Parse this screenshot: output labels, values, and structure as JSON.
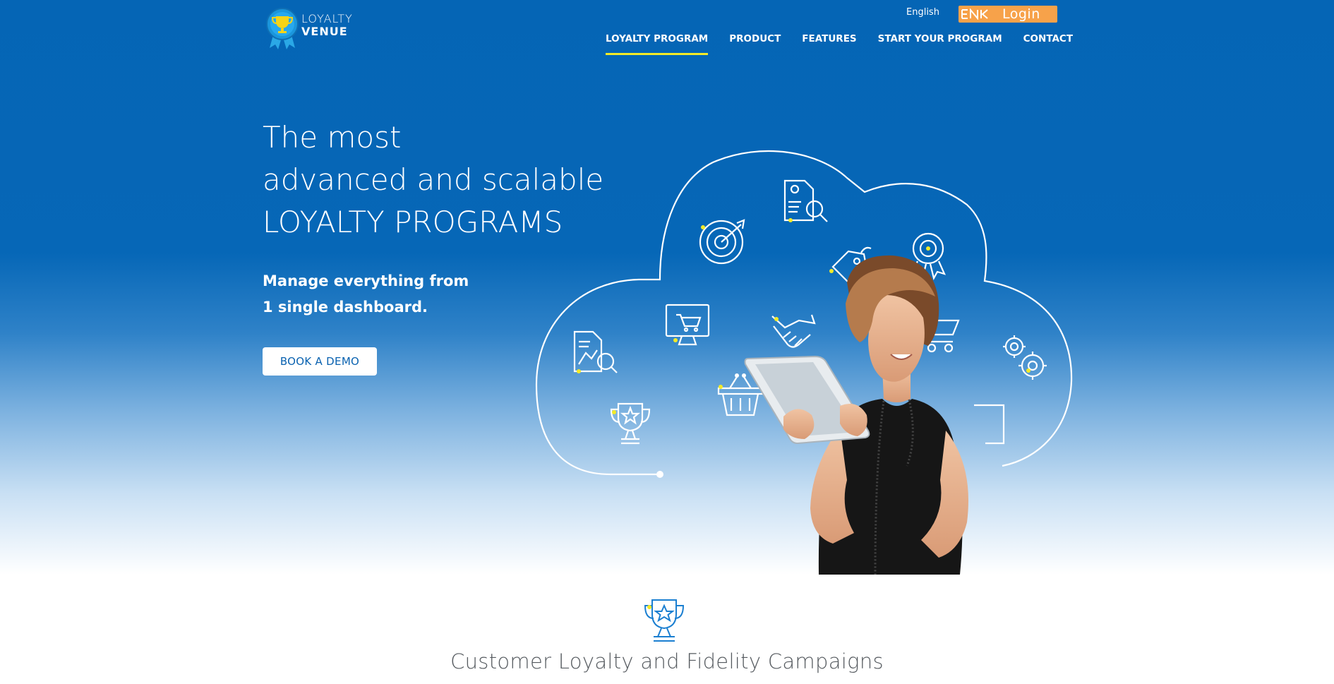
{
  "brand": {
    "line1": "LOYALTY",
    "line2": "VENUE",
    "logo_icon": "trophy-ribbon-icon"
  },
  "header": {
    "language": "English",
    "login_prefix": "ENK",
    "login_label": "Login"
  },
  "nav": {
    "items": [
      {
        "label": "LOYALTY PROGRAM",
        "active": true
      },
      {
        "label": "PRODUCT"
      },
      {
        "label": "FEATURES"
      },
      {
        "label": "START YOUR PROGRAM"
      },
      {
        "label": "CONTACT"
      }
    ]
  },
  "hero": {
    "headline": [
      "The most",
      "advanced and scalable",
      "LOYALTY PROGRAMS"
    ],
    "subline": [
      "Manage everything from",
      "1 single dashboard."
    ],
    "cta_label": "BOOK A DEMO"
  },
  "section": {
    "title": "Customer Loyalty and Fidelity Campaigns",
    "icon": "trophy-star-icon"
  },
  "colors": {
    "primary": "#0565b5",
    "accent": "#f3ea28",
    "login": "#f7a24a"
  }
}
